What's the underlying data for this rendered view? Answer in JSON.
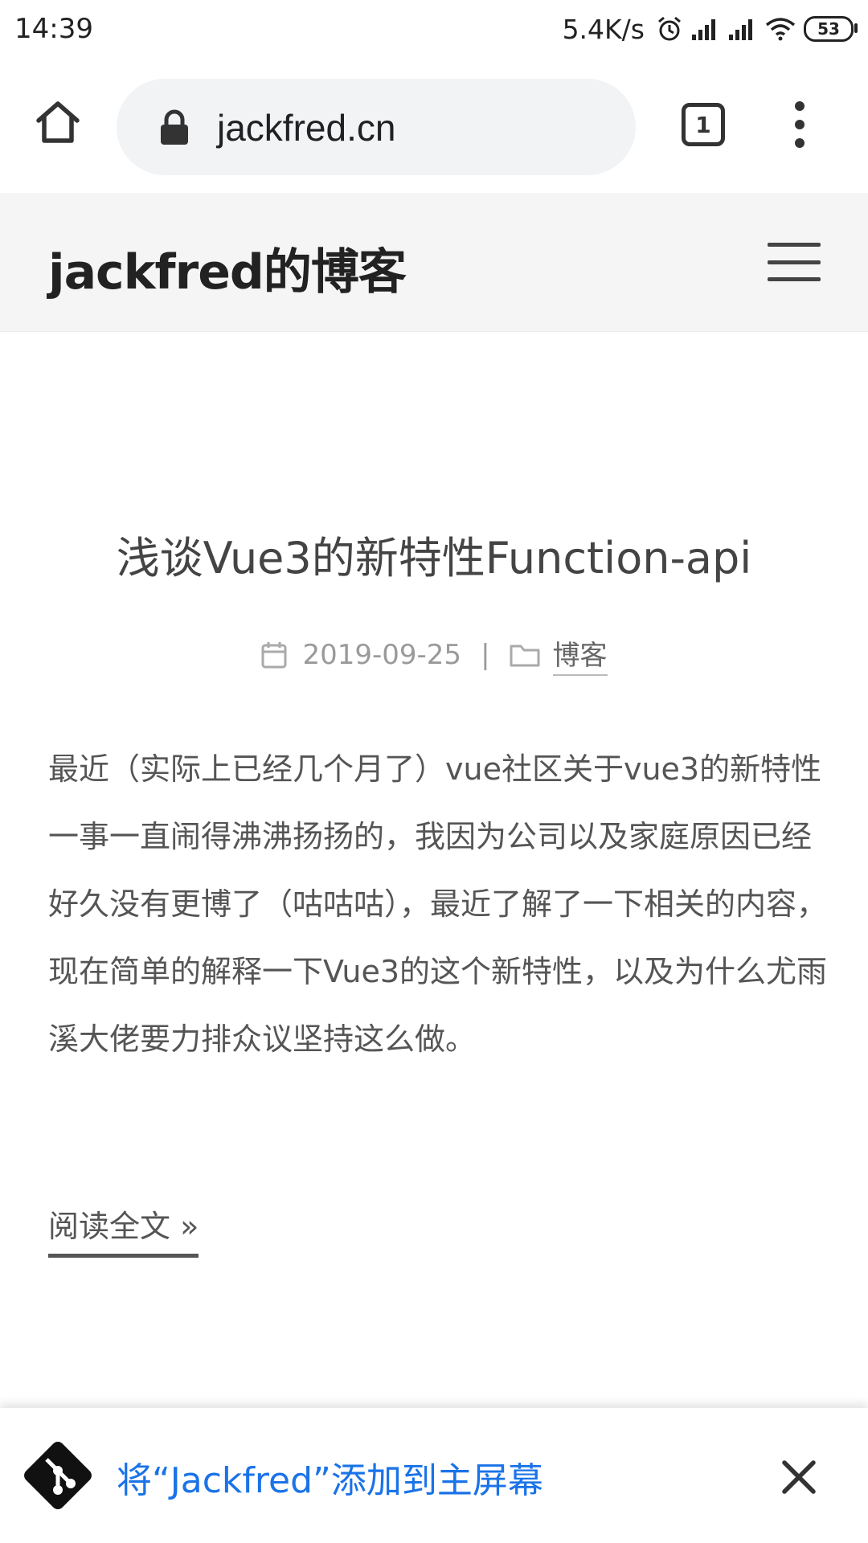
{
  "status_bar": {
    "time": "14:39",
    "net_speed": "5.4K/s",
    "battery": "53"
  },
  "browser": {
    "url": "jackfred.cn",
    "tab_count": "1"
  },
  "site": {
    "title": "jackfred的博客"
  },
  "post": {
    "title": "浅谈Vue3的新特性Function-api",
    "date": "2019-09-25",
    "separator": "|",
    "category": "博客",
    "excerpt": "最近（实际上已经几个月了）vue社区关于vue3的新特性一事一直闹得沸沸扬扬的，我因为公司以及家庭原因已经好久没有更博了（咕咕咕），最近了解了一下相关的内容，现在简单的解释一下Vue3的这个新特性，以及为什么尤雨溪大佬要力排众议坚持这么做。",
    "read_more": "阅读全文 »"
  },
  "a2hs": {
    "text": "将“Jackfred”添加到主屏幕"
  },
  "icons": {
    "home": "home-icon",
    "lock": "lock-icon",
    "tabs": "tab-switcher-icon",
    "menu": "more-vert-icon",
    "hamburger": "menu-icon",
    "calendar": "calendar-icon",
    "folder": "folder-icon",
    "git": "git-logo-icon",
    "close": "close-icon"
  },
  "colors": {
    "link_blue": "#1a73e8",
    "header_bg": "#f5f5f5",
    "url_pill_bg": "#f1f3f4"
  }
}
